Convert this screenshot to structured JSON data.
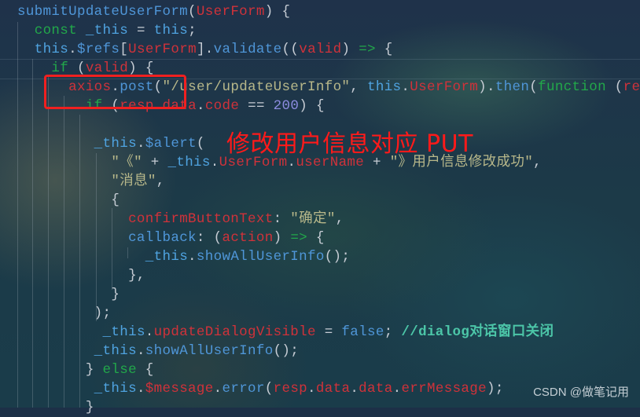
{
  "editor": {
    "theme_colors": {
      "function": "#4f96d8",
      "keyword": "#22a84a",
      "variable": "#d0323a",
      "string": "#b8b88a",
      "number": "#8c8cdf",
      "comment": "#4cc6a8"
    },
    "lines": [
      [
        {
          "t": "fn",
          "v": "submitUpdateUserForm"
        },
        {
          "t": "pl",
          "v": "("
        },
        {
          "t": "vr",
          "v": "UserForm"
        },
        {
          "t": "pl",
          "v": ") {"
        }
      ],
      [
        {
          "t": "pl",
          "v": "  "
        },
        {
          "t": "kw",
          "v": "const"
        },
        {
          "t": "th",
          "v": " _this"
        },
        {
          "t": "pl",
          "v": " = "
        },
        {
          "t": "th",
          "v": "this"
        },
        {
          "t": "pl",
          "v": ";"
        }
      ],
      [
        {
          "t": "pl",
          "v": "  "
        },
        {
          "t": "th",
          "v": "this"
        },
        {
          "t": "pl",
          "v": "."
        },
        {
          "t": "fn",
          "v": "$refs"
        },
        {
          "t": "pl",
          "v": "["
        },
        {
          "t": "vr",
          "v": "UserForm"
        },
        {
          "t": "pl",
          "v": "]."
        },
        {
          "t": "fn",
          "v": "validate"
        },
        {
          "t": "pl",
          "v": "(("
        },
        {
          "t": "vr",
          "v": "valid"
        },
        {
          "t": "pl",
          "v": ") "
        },
        {
          "t": "kw",
          "v": "=>"
        },
        {
          "t": "pl",
          "v": " {"
        }
      ],
      [
        {
          "t": "pl",
          "v": "    "
        },
        {
          "t": "kw",
          "v": "if"
        },
        {
          "t": "pl",
          "v": " ("
        },
        {
          "t": "vr",
          "v": "valid"
        },
        {
          "t": "pl",
          "v": ") {"
        }
      ],
      [
        {
          "t": "pl",
          "v": "      "
        },
        {
          "t": "vr",
          "v": "axios"
        },
        {
          "t": "pl",
          "v": "."
        },
        {
          "t": "fn",
          "v": "post"
        },
        {
          "t": "pl",
          "v": "("
        },
        {
          "t": "st",
          "v": "\"/user/updateUserInfo\""
        },
        {
          "t": "pl",
          "v": ", "
        },
        {
          "t": "th",
          "v": "this"
        },
        {
          "t": "pl",
          "v": "."
        },
        {
          "t": "vr",
          "v": "UserForm"
        },
        {
          "t": "pl",
          "v": ")."
        },
        {
          "t": "fn",
          "v": "then"
        },
        {
          "t": "pl",
          "v": "("
        },
        {
          "t": "kw",
          "v": "function"
        },
        {
          "t": "pl",
          "v": " ("
        },
        {
          "t": "vr",
          "v": "resp"
        },
        {
          "t": "pl",
          "v": ") {"
        }
      ],
      [
        {
          "t": "pl",
          "v": "        "
        },
        {
          "t": "kw",
          "v": "if"
        },
        {
          "t": "pl",
          "v": " ("
        },
        {
          "t": "vr",
          "v": "resp"
        },
        {
          "t": "pl",
          "v": "."
        },
        {
          "t": "vr",
          "v": "data"
        },
        {
          "t": "pl",
          "v": "."
        },
        {
          "t": "vr",
          "v": "code"
        },
        {
          "t": "pl",
          "v": " == "
        },
        {
          "t": "nm",
          "v": "200"
        },
        {
          "t": "pl",
          "v": ") {"
        }
      ],
      [
        {
          "t": "pl",
          "v": ""
        }
      ],
      [
        {
          "t": "pl",
          "v": "         "
        },
        {
          "t": "th",
          "v": "_this"
        },
        {
          "t": "pl",
          "v": "."
        },
        {
          "t": "fn",
          "v": "$alert"
        },
        {
          "t": "pl",
          "v": "("
        }
      ],
      [
        {
          "t": "pl",
          "v": "           "
        },
        {
          "t": "st",
          "v": "\"《\""
        },
        {
          "t": "pl",
          "v": " + "
        },
        {
          "t": "th",
          "v": "_this"
        },
        {
          "t": "pl",
          "v": "."
        },
        {
          "t": "vr",
          "v": "UserForm"
        },
        {
          "t": "pl",
          "v": "."
        },
        {
          "t": "vr",
          "v": "userName"
        },
        {
          "t": "pl",
          "v": " + "
        },
        {
          "t": "st",
          "v": "\"》用户信息修改成功\""
        },
        {
          "t": "pl",
          "v": ","
        }
      ],
      [
        {
          "t": "pl",
          "v": "           "
        },
        {
          "t": "st",
          "v": "\"消息\""
        },
        {
          "t": "pl",
          "v": ","
        }
      ],
      [
        {
          "t": "pl",
          "v": "           {"
        }
      ],
      [
        {
          "t": "pl",
          "v": "             "
        },
        {
          "t": "vr",
          "v": "confirmButtonText"
        },
        {
          "t": "pl",
          "v": ": "
        },
        {
          "t": "st",
          "v": "\"确定\""
        },
        {
          "t": "pl",
          "v": ","
        }
      ],
      [
        {
          "t": "pl",
          "v": "             "
        },
        {
          "t": "fn",
          "v": "callback"
        },
        {
          "t": "pl",
          "v": ": ("
        },
        {
          "t": "vr",
          "v": "action"
        },
        {
          "t": "pl",
          "v": ") "
        },
        {
          "t": "kw",
          "v": "=>"
        },
        {
          "t": "pl",
          "v": " {"
        }
      ],
      [
        {
          "t": "pl",
          "v": "               "
        },
        {
          "t": "th",
          "v": "_this"
        },
        {
          "t": "pl",
          "v": "."
        },
        {
          "t": "fn",
          "v": "showAllUserInfo"
        },
        {
          "t": "pl",
          "v": "();"
        }
      ],
      [
        {
          "t": "pl",
          "v": "             },"
        }
      ],
      [
        {
          "t": "pl",
          "v": "           }"
        }
      ],
      [
        {
          "t": "pl",
          "v": "         );"
        }
      ],
      [
        {
          "t": "pl",
          "v": "          "
        },
        {
          "t": "th",
          "v": "_this"
        },
        {
          "t": "pl",
          "v": "."
        },
        {
          "t": "vr",
          "v": "updateDialogVisible"
        },
        {
          "t": "pl",
          "v": " = "
        },
        {
          "t": "fn",
          "v": "false"
        },
        {
          "t": "pl",
          "v": "; "
        },
        {
          "t": "cm",
          "v": "//dialog对话窗口关闭"
        }
      ],
      [
        {
          "t": "pl",
          "v": "         "
        },
        {
          "t": "th",
          "v": "_this"
        },
        {
          "t": "pl",
          "v": "."
        },
        {
          "t": "fn",
          "v": "showAllUserInfo"
        },
        {
          "t": "pl",
          "v": "();"
        }
      ],
      [
        {
          "t": "pl",
          "v": "        } "
        },
        {
          "t": "kw",
          "v": "else"
        },
        {
          "t": "pl",
          "v": " {"
        }
      ],
      [
        {
          "t": "pl",
          "v": "         "
        },
        {
          "t": "th",
          "v": "_this"
        },
        {
          "t": "pl",
          "v": "."
        },
        {
          "t": "vr",
          "v": "$message"
        },
        {
          "t": "pl",
          "v": "."
        },
        {
          "t": "fn",
          "v": "error"
        },
        {
          "t": "pl",
          "v": "("
        },
        {
          "t": "vr",
          "v": "resp"
        },
        {
          "t": "pl",
          "v": "."
        },
        {
          "t": "vr",
          "v": "data"
        },
        {
          "t": "pl",
          "v": "."
        },
        {
          "t": "vr",
          "v": "data"
        },
        {
          "t": "pl",
          "v": "."
        },
        {
          "t": "vr",
          "v": "errMessage"
        },
        {
          "t": "pl",
          "v": ");"
        }
      ],
      [
        {
          "t": "pl",
          "v": "        }"
        }
      ]
    ]
  },
  "annotation": {
    "text": "修改用户信息对应 PUT",
    "color": "#ff1a1a",
    "highlighted_code": "axios.post"
  },
  "watermark": {
    "text": "CSDN @做笔记用"
  }
}
